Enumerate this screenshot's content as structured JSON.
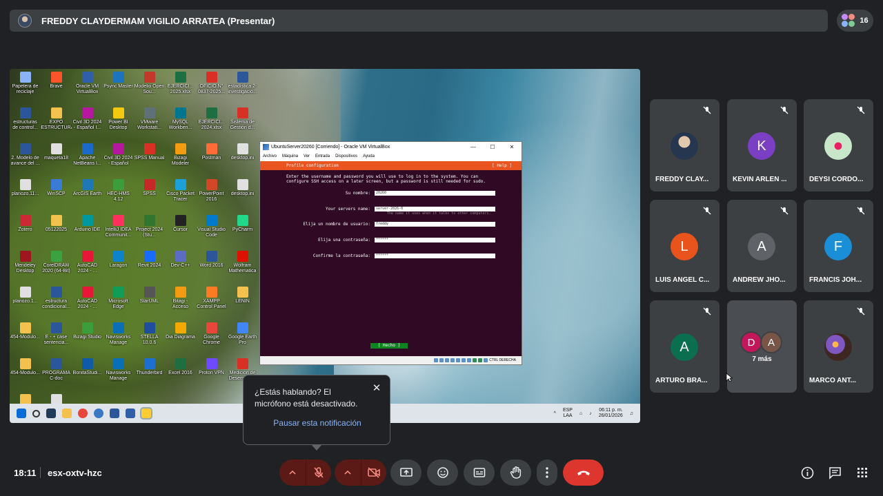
{
  "presenter": {
    "name": "FREDDY CLAYDERMAM VIGILIO ARRATEA (Presentar)",
    "participants_count": "16"
  },
  "shared_screen": {
    "desktop_icons": [
      {
        "label": "Papelera de reciclaje",
        "color": "#8ab4f8"
      },
      {
        "label": "Brave",
        "color": "#fb542b"
      },
      {
        "label": "Oracle VM VirtualBox",
        "color": "#2f5fa8"
      },
      {
        "label": "Psync Master",
        "color": "#1e73be"
      },
      {
        "label": "Modelio Open Sou...",
        "color": "#c0392b"
      },
      {
        "label": "EJERCICI... 2025.xlsx",
        "color": "#1d6f42"
      },
      {
        "label": "OFICIO N° 0837-2025...",
        "color": "#d93025"
      },
      {
        "label": "estadística 2- investigació...",
        "color": "#2b579a"
      },
      {
        "label": "estructuras de control...",
        "color": "#2b579a"
      },
      {
        "label": "EXPO ESTRUCTURA",
        "color": "#f2c14e"
      },
      {
        "label": "Civil 3D 2024 - Español I...",
        "color": "#b5179e"
      },
      {
        "label": "Power BI Desktop",
        "color": "#f2c811"
      },
      {
        "label": "VMware Workstati...",
        "color": "#607078"
      },
      {
        "label": "MySQL Workben...",
        "color": "#00758f"
      },
      {
        "label": "EJERCICI... 2024.xlsx",
        "color": "#1d6f42"
      },
      {
        "label": "Sistema de Gestión d...",
        "color": "#d93025"
      },
      {
        "label": "2. Modelo de avance del ...",
        "color": "#2b579a"
      },
      {
        "label": "maqueta18",
        "color": "#e0e0e0"
      },
      {
        "label": "Apache NetBeans I...",
        "color": "#1b6ac9"
      },
      {
        "label": "Civil 3D 2024 - Español",
        "color": "#b5179e"
      },
      {
        "label": "SPSS Manual",
        "color": "#d93025"
      },
      {
        "label": "Bizagi Modeler",
        "color": "#f39c12"
      },
      {
        "label": "Postman",
        "color": "#ff6c37"
      },
      {
        "label": "desktop.ini",
        "color": "#e0e0e0"
      },
      {
        "label": "planozo.11...",
        "color": "#e0e0e0"
      },
      {
        "label": "WinSCP",
        "color": "#3a7bd5"
      },
      {
        "label": "ArcGIS Earth",
        "color": "#1f78b4"
      },
      {
        "label": "HEC-HMS 4.12",
        "color": "#3c9d3c"
      },
      {
        "label": "SPSS",
        "color": "#c62828"
      },
      {
        "label": "Cisco Packet Tracer",
        "color": "#1ba0d7"
      },
      {
        "label": "PowerPoint 2016",
        "color": "#d24726"
      },
      {
        "label": "desktop.ini",
        "color": "#e0e0e0"
      },
      {
        "label": "Zotero",
        "color": "#cc2936"
      },
      {
        "label": "05122025",
        "color": "#f2c14e"
      },
      {
        "label": "Arduino IDE",
        "color": "#00979d"
      },
      {
        "label": "IntelliJ IDEA Communit...",
        "color": "#fe315d"
      },
      {
        "label": "Project 2024 (Stu...",
        "color": "#31752f"
      },
      {
        "label": "Cursor",
        "color": "#222222"
      },
      {
        "label": "Visual Studio Code",
        "color": "#007acc"
      },
      {
        "label": "PyCharm",
        "color": "#21d789"
      },
      {
        "label": "Mendeley Desktop",
        "color": "#9d1620"
      },
      {
        "label": "CorelDRAW 2020 (64-Bit)",
        "color": "#3aa241"
      },
      {
        "label": "AutoCAD 2024 - ...",
        "color": "#e51937"
      },
      {
        "label": "Laragon",
        "color": "#0e83cd"
      },
      {
        "label": "Revit 2024",
        "color": "#186bff"
      },
      {
        "label": "Dev-C++",
        "color": "#5b6cc2"
      },
      {
        "label": "Word 2016",
        "color": "#2b579a"
      },
      {
        "label": "Wolfram Mathematica",
        "color": "#dd1100"
      },
      {
        "label": "planozo.1...",
        "color": "#e0e0e0"
      },
      {
        "label": "estructura condicional...",
        "color": "#2b579a"
      },
      {
        "label": "AutoCAD 2024 - ...",
        "color": "#e51937"
      },
      {
        "label": "Microsoft Edge",
        "color": "#0f9d58"
      },
      {
        "label": "StarUML",
        "color": "#555555"
      },
      {
        "label": "Bitagi - Acceso directo",
        "color": "#f39c12"
      },
      {
        "label": "XAMPP Control Panel",
        "color": "#fb7a24"
      },
      {
        "label": "LENIN",
        "color": "#f2c14e"
      },
      {
        "label": "454-Modulo...",
        "color": "#f2c14e"
      },
      {
        "label": "E - + case sentencia...",
        "color": "#2b579a"
      },
      {
        "label": "Bizagi Studio",
        "color": "#3c9d3c"
      },
      {
        "label": "Navisworks Manage 202...",
        "color": "#0b6fb8"
      },
      {
        "label": "STELLA 10.0.6",
        "color": "#1f4e9c"
      },
      {
        "label": "Dia Diagrama",
        "color": "#f2a900"
      },
      {
        "label": "Google Chrome",
        "color": "#e8453c"
      },
      {
        "label": "Google Earth Pro",
        "color": "#4285f4"
      },
      {
        "label": "454-Modulo...",
        "color": "#f2c14e"
      },
      {
        "label": "PROGRAMA C-doc",
        "color": "#2b579a"
      },
      {
        "label": "BonitaStudi...",
        "color": "#0f5ba7"
      },
      {
        "label": "Navisworks Manage 2024...",
        "color": "#0b6fb8"
      },
      {
        "label": "Thunderbird",
        "color": "#1f6fd0"
      },
      {
        "label": "Excel 2016",
        "color": "#1d6f42"
      },
      {
        "label": "Proton VPN",
        "color": "#6d4aff"
      },
      {
        "label": "Medición de Desempeñ...",
        "color": "#d93025"
      },
      {
        "label": "454-Modulo...",
        "color": "#f2c14e"
      },
      {
        "label": "maqu...",
        "color": "#e0e0e0"
      }
    ],
    "vbox": {
      "title": "UbuntuServer20260 [Corriendo] - Oracle VM VirtualBox",
      "controls": [
        "—",
        "☐",
        "✕"
      ],
      "menu": [
        "Archivo",
        "Máquina",
        "Ver",
        "Entrada",
        "Dispositivos",
        "Ayuda"
      ],
      "header": "Profile configuration",
      "help": "[ Help ]",
      "intro": "Enter the username and password you will use to log in to the system. You can configure SSH access on a later screen, but a password is still needed for sudo.",
      "fields": [
        {
          "label": "Su nombre:",
          "value": "20260"
        },
        {
          "label": "Your servers name:",
          "value": "server-2026-0"
        },
        {
          "label": "Elija un nombre de usuario:",
          "value": "freddy"
        },
        {
          "label": "Elija una contraseña:",
          "value": "******"
        },
        {
          "label": "Confirme la contraseña:",
          "value": "******"
        }
      ],
      "server_name_hint": "The name it uses when it talks to other computers.",
      "done_button": "[ Hecho ]",
      "host_key": "CTRL DERECHA"
    },
    "taskbar": {
      "lang_line1": "ESP",
      "lang_line2": "LAA",
      "time": "06:11 p. m.",
      "date": "26/01/2026",
      "tray_arrow": "^"
    }
  },
  "participants": [
    {
      "name": "FREDDY CLAY...",
      "initial": "",
      "color": "#3c5a80",
      "photo": true
    },
    {
      "name": "KEVIN ARLEN ...",
      "initial": "K",
      "color": "#7b3fc4"
    },
    {
      "name": "DEYSI CORDO...",
      "initial": "",
      "color": "#4caf50",
      "photo": true
    },
    {
      "name": "LUIS ANGEL C...",
      "initial": "L",
      "color": "#e8541b"
    },
    {
      "name": "ANDREW JHO...",
      "initial": "A",
      "color": "#5f6368"
    },
    {
      "name": "FRANCIS JOH...",
      "initial": "F",
      "color": "#1a8fd8"
    },
    {
      "name": "ARTURO BRA...",
      "initial": "A",
      "color": "#0b6e4f"
    },
    {
      "name": "MARCO ANT...",
      "initial": "",
      "color": "#8a5a9e",
      "photo": true
    }
  ],
  "more_tile": {
    "avatars": [
      {
        "initial": "D",
        "color": "#c2185b"
      },
      {
        "initial": "A",
        "color": "#795548"
      }
    ],
    "label": "7 más"
  },
  "notification": {
    "message": "¿Estás hablando? El micrófono está desactivado.",
    "action": "Pausar esta notificación"
  },
  "footer": {
    "time": "18:11",
    "meeting_code": "esx-oxtv-hzc"
  },
  "colors": {
    "background": "#202124",
    "tile": "#3c4043",
    "muted_red": "#5c1a17",
    "end_call": "#dc362e",
    "link": "#8ab4f8",
    "ubuntu_orange": "#e95420"
  }
}
